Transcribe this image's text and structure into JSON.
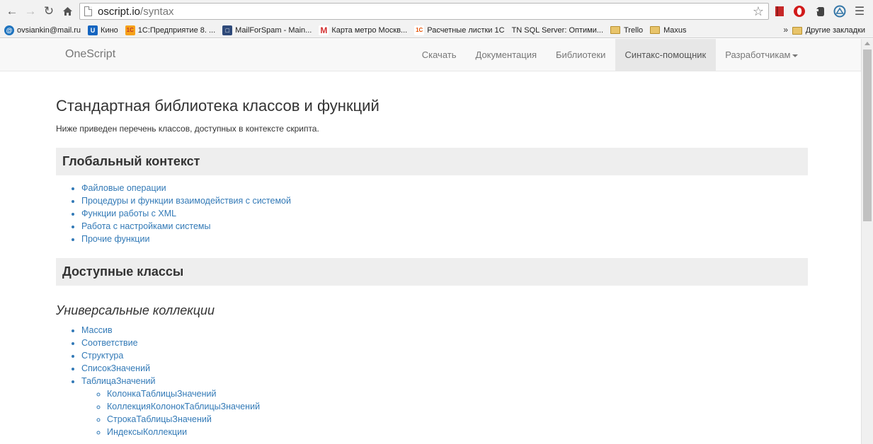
{
  "browser": {
    "url_host": "oscript.io",
    "url_path": "/syntax",
    "bookmarks": [
      {
        "label": "ovsiankin@mail.ru",
        "icon": "mail-icon",
        "color": "#1e73be"
      },
      {
        "label": "Кино",
        "icon": "u-icon",
        "color": "#1565c0"
      },
      {
        "label": "1С:Предприятие 8. ...",
        "icon": "1c-icon",
        "color": "#f6a21a"
      },
      {
        "label": "MailForSpam - Main...",
        "icon": "document-icon",
        "color": "#2f4a7a"
      },
      {
        "label": "Карта метро Москв...",
        "icon": "metro-icon",
        "color": "#d32f2f"
      },
      {
        "label": "Расчетные листки 1С",
        "icon": "1c-icon",
        "color": "#f6a21a"
      },
      {
        "label": "TN SQL Server: Оптими...",
        "icon": "tn-icon",
        "color": ""
      },
      {
        "label": "Trello",
        "icon": "folder-icon",
        "color": ""
      },
      {
        "label": "Maxus",
        "icon": "folder-icon",
        "color": ""
      }
    ],
    "bookmarks_overflow": "»",
    "other_bookmarks": "Другие закладки"
  },
  "navbar": {
    "brand": "OneScript",
    "items": [
      {
        "label": "Скачать",
        "active": false
      },
      {
        "label": "Документация",
        "active": false
      },
      {
        "label": "Библиотеки",
        "active": false
      },
      {
        "label": "Синтакс-помощник",
        "active": true
      },
      {
        "label": "Разработчикам",
        "active": false,
        "dropdown": true
      }
    ]
  },
  "main": {
    "title": "Стандартная библиотека классов и функций",
    "lead": "Ниже приведен перечень классов, доступных в контексте скрипта.",
    "global_context": {
      "heading": "Глобальный контекст",
      "links": [
        "Файловые операции",
        "Процедуры и функции взаимодействия с системой",
        "Функции работы с XML",
        "Работа с настройками системы",
        "Прочие функции"
      ]
    },
    "classes": {
      "heading": "Доступные классы",
      "groups": [
        {
          "title": "Универсальные коллекции",
          "items": [
            {
              "label": "Массив"
            },
            {
              "label": "Соответствие"
            },
            {
              "label": "Структура"
            },
            {
              "label": "СписокЗначений"
            },
            {
              "label": "ТаблицаЗначений",
              "children": [
                "КолонкаТаблицыЗначений",
                "КоллекцияКолонокТаблицыЗначений",
                "СтрокаТаблицыЗначений",
                "ИндексыКоллекции"
              ]
            }
          ]
        }
      ]
    }
  }
}
